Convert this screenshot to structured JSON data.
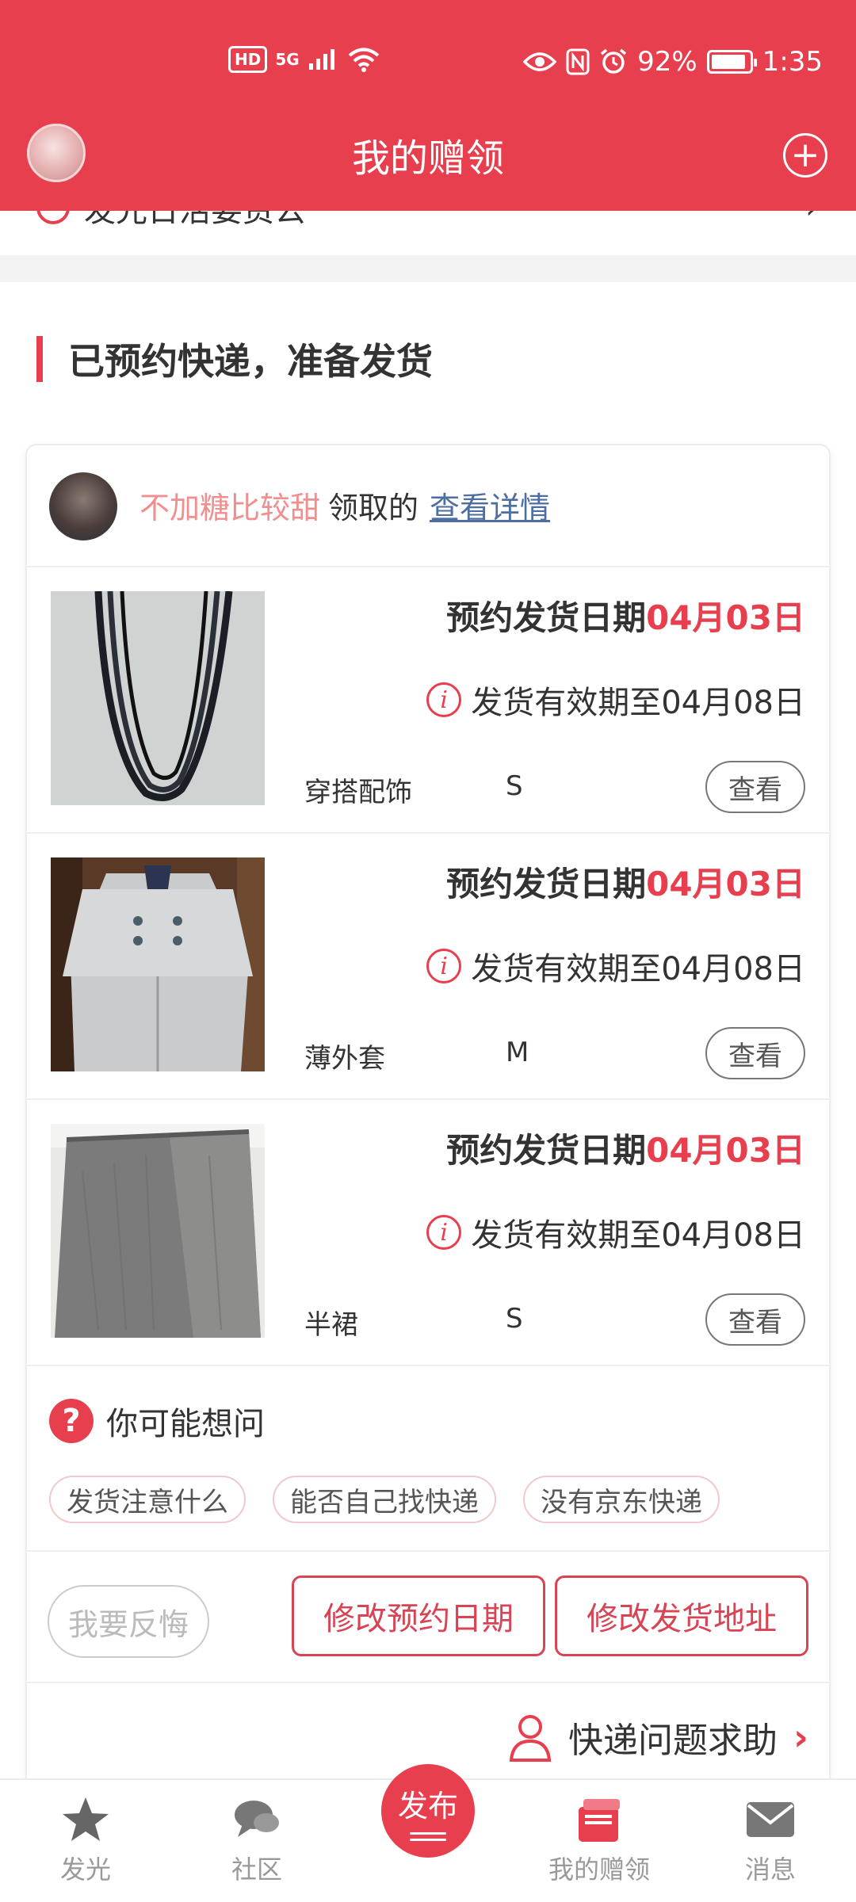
{
  "status_bar": {
    "hd": "HD",
    "network": "5G",
    "battery_percent": "92%",
    "battery_level": 0.92,
    "time": "1:35"
  },
  "header": {
    "title": "我的赠领"
  },
  "previous_section": {
    "label": "发光日活要资公"
  },
  "section": {
    "title": "已预约快递，准备发货"
  },
  "card": {
    "receiver_name": "不加糖比较甜",
    "receiver_suffix": "领取的",
    "detail_link": "查看详情",
    "items": [
      {
        "ship_label": "预约发货日期",
        "ship_date": "04月03日",
        "validity": "发货有效期至04月08日",
        "category": "穿搭配饰",
        "size": "S",
        "view_label": "查看"
      },
      {
        "ship_label": "预约发货日期",
        "ship_date": "04月03日",
        "validity": "发货有效期至04月08日",
        "category": "薄外套",
        "size": "M",
        "view_label": "查看"
      },
      {
        "ship_label": "预约发货日期",
        "ship_date": "04月03日",
        "validity": "发货有效期至04月08日",
        "category": "半裙",
        "size": "S",
        "view_label": "查看"
      }
    ],
    "faq": {
      "title": "你可能想问",
      "chips": [
        "发货注意什么",
        "能否自己找快递",
        "没有京东快递"
      ]
    },
    "actions": {
      "regret": "我要反悔",
      "change_date": "修改预约日期",
      "change_address": "修改发货地址"
    },
    "help": {
      "label": "快递问题求助"
    }
  },
  "bottom_nav": {
    "items": [
      {
        "label": "发光",
        "icon": "star-icon"
      },
      {
        "label": "社区",
        "icon": "chat-icon"
      },
      {
        "label": "发布",
        "icon": "publish-icon"
      },
      {
        "label": "我的赠领",
        "icon": "gift-box-icon",
        "active": true
      },
      {
        "label": "消息",
        "icon": "mail-icon"
      }
    ]
  },
  "colors": {
    "brand": "#e83f4f",
    "receiver_name": "#ef8f8f",
    "link": "#4c6ea0"
  }
}
